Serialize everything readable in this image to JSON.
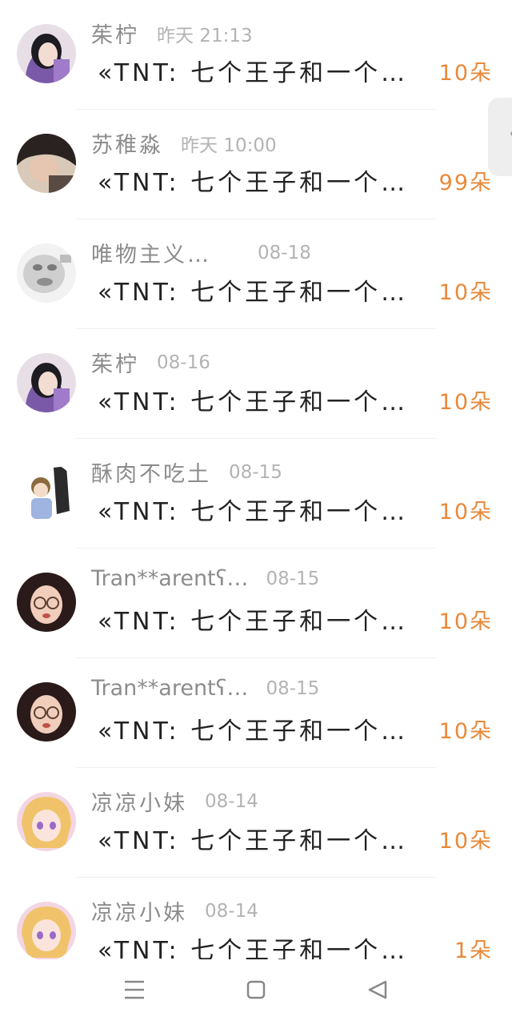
{
  "conversations": [
    {
      "name": "茱柠",
      "time": "昨天 21:13",
      "message": "«TNT: 七个王子和一个…",
      "count": "10朵",
      "avatar": "avatar-girl-purple"
    },
    {
      "name": "苏稚淼",
      "time": "昨天 10:00",
      "message": "«TNT: 七个王子和一个…",
      "count": "99朵",
      "avatar": "avatar-girl-hat"
    },
    {
      "name": "唯物主义…",
      "time": "08-18",
      "message": "«TNT: 七个王子和一个…",
      "count": "10朵",
      "avatar": "avatar-blurred-meme"
    },
    {
      "name": "茱柠",
      "time": "08-16",
      "message": "«TNT: 七个王子和一个…",
      "count": "10朵",
      "avatar": "avatar-girl-purple"
    },
    {
      "name": "酥肉不吃土",
      "time": "08-15",
      "message": "«TNT: 七个王子和一个…",
      "count": "10朵",
      "avatar": "avatar-cartoon-boy"
    },
    {
      "name": "Tran**arentʕ…",
      "time": "08-15",
      "message": "«TNT: 七个王子和一个…",
      "count": "10朵",
      "avatar": "avatar-girl-glasses"
    },
    {
      "name": "Tran**arentʕ…",
      "time": "08-15",
      "message": "«TNT: 七个王子和一个…",
      "count": "10朵",
      "avatar": "avatar-girl-glasses"
    },
    {
      "name": "凉凉小妹",
      "time": "08-14",
      "message": "«TNT: 七个王子和一个…",
      "count": "10朵",
      "avatar": "avatar-anime-girl"
    },
    {
      "name": "凉凉小妹",
      "time": "08-14",
      "message": "«TNT: 七个王子和一个…",
      "count": "1朵",
      "avatar": "avatar-anime-girl"
    }
  ],
  "side_tab": {
    "icon": "chevron-left-icon",
    "glyph": "〈"
  },
  "nav": {
    "menu_icon": "menu-icon",
    "home_icon": "home-square-icon",
    "back_icon": "back-triangle-icon"
  },
  "colors": {
    "count": "#e8893a",
    "name": "#8c8c8c",
    "time": "#b3b3b3",
    "message": "#222222"
  }
}
